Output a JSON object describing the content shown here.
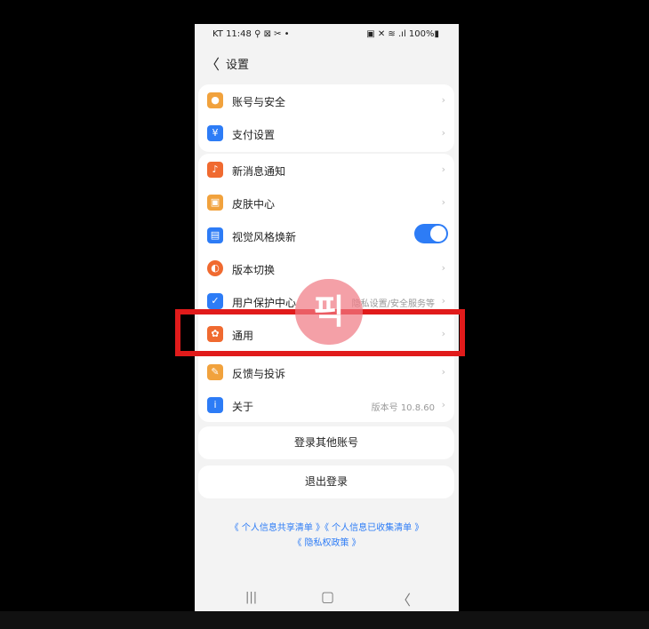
{
  "status": {
    "left": "KT 11:48 ⚲ ⊠ ✂ •",
    "right": "▣ ✕ ≋ .ıl 100%▮"
  },
  "header": {
    "back": "〈",
    "title": "设置"
  },
  "groups": {
    "account": [
      {
        "label": "账号与安全",
        "icon_color": "#f1a23d"
      },
      {
        "label": "支付设置",
        "icon_color": "#2d7cf6"
      }
    ],
    "main": [
      {
        "label": "新消息通知",
        "icon_color": "#f06a30"
      },
      {
        "label": "皮肤中心",
        "icon_color": "#f1a23d"
      },
      {
        "label": "视觉风格焕新",
        "icon_color": "#2d7cf6"
      },
      {
        "label": "版本切换",
        "icon_color": "#f06a30"
      },
      {
        "label": "用户保护中心",
        "value": "隐私设置/安全服务等",
        "icon_color": "#2d7cf6"
      },
      {
        "label": "通用",
        "icon_color": "#f06a30"
      },
      {
        "label": "反馈与投诉",
        "icon_color": "#f1a23d"
      },
      {
        "label": "关于",
        "value": "版本号 10.8.60",
        "icon_color": "#2d7cf6"
      }
    ]
  },
  "buttons": {
    "login_other": "登录其他账号",
    "logout": "退出登录"
  },
  "links": {
    "line1": "《 个人信息共享清单 》《 个人信息已收集清单 》",
    "line2": "《 隐私权政策 》"
  },
  "nav": {
    "recent": "|||",
    "home": "▢",
    "back": "〈"
  },
  "overlay": {
    "sticker_text": "픽"
  },
  "colors": {
    "accent": "#2d7cf6",
    "highlight": "#e11b1b"
  }
}
